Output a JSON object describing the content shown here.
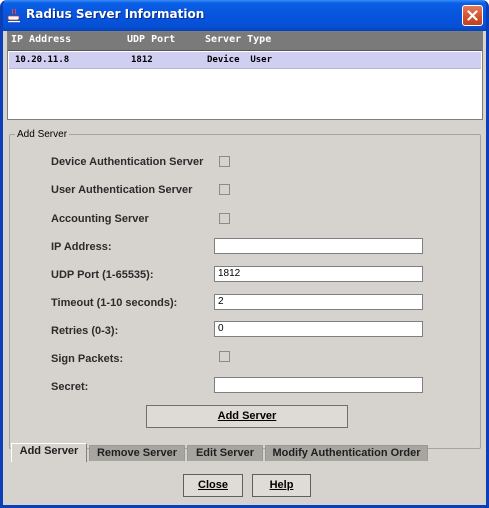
{
  "window": {
    "title": "Radius Server Information"
  },
  "server_list": {
    "columns": [
      "IP Address",
      "UDP Port",
      "Server Type"
    ],
    "rows": [
      {
        "ip": "10.20.11.8",
        "port": "1812",
        "type": "Device  User"
      }
    ]
  },
  "add_server": {
    "legend": "Add Server",
    "device_auth_label": "Device Authentication Server",
    "user_auth_label": "User Authentication Server",
    "accounting_label": "Accounting Server",
    "ip_label": "IP Address:",
    "ip_value": "",
    "udp_label": "UDP Port (1-65535):",
    "udp_value": "1812",
    "timeout_label": "Timeout (1-10 seconds):",
    "timeout_value": "2",
    "retries_label": "Retries (0-3):",
    "retries_value": "0",
    "sign_label": "Sign Packets:",
    "secret_label": "Secret:",
    "secret_value": "",
    "button": "Add Server"
  },
  "tabs": [
    "Add Server",
    "Remove Server",
    "Edit Server",
    "Modify Authentication Order"
  ],
  "footer": {
    "close": "Close",
    "help": "Help"
  },
  "colors": {
    "titlebar": "#0754dc",
    "close_button": "#d14e2c",
    "panel": "#d6d3ce",
    "selected_row": "#d0cff2"
  }
}
